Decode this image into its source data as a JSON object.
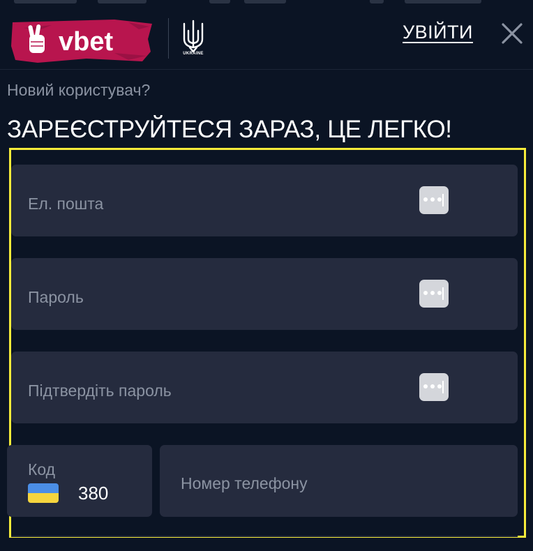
{
  "header": {
    "brand": "vbet",
    "partner_badge": "UKRAINE",
    "login_label": "УВІЙТИ",
    "close_icon": "close-icon"
  },
  "intro": {
    "new_user": "Новий користувач?",
    "headline": "ЗАРЕЄСТРУЙТЕСЯ ЗАРАЗ, ЦЕ ЛЕГКО!"
  },
  "form": {
    "email": {
      "placeholder": "Ел. пошта",
      "icon": "password-manager-icon"
    },
    "password": {
      "placeholder": "Пароль",
      "icon": "password-manager-icon"
    },
    "confirm_password": {
      "placeholder": "Підтвердіть пароль",
      "icon": "password-manager-icon"
    },
    "phone_code": {
      "label": "Код",
      "flag": "ukraine-flag-icon",
      "value": "380"
    },
    "phone_number": {
      "placeholder": "Номер телефону"
    }
  },
  "colors": {
    "background": "#0b1424",
    "field_background": "#252b3e",
    "placeholder_text": "#8b93a2",
    "brand_accent": "#b8154e",
    "highlight_frame": "#f7ec3a"
  }
}
